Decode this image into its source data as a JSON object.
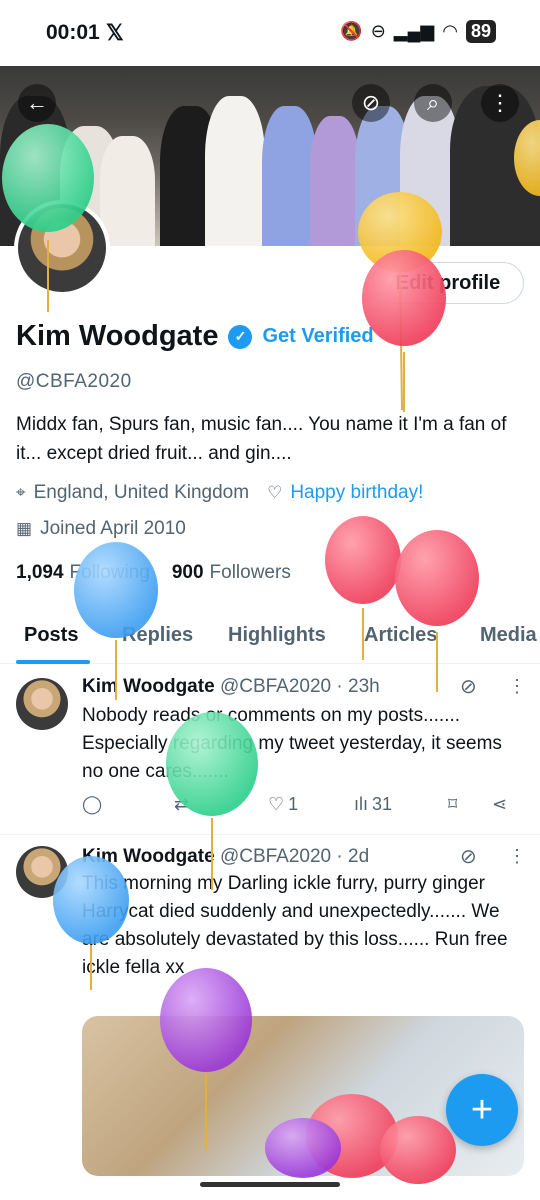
{
  "status_bar": {
    "time": "00:01",
    "x_glyph": "𝕏",
    "icons": [
      "mute-icon",
      "dnd-icon",
      "signal-icon",
      "wifi-icon"
    ],
    "battery": "89"
  },
  "banner": {
    "back_icon": "←",
    "grok_icon": "⊘",
    "search_icon": "⌕",
    "more_icon": "⋮"
  },
  "profile": {
    "edit_label": "Edit profile",
    "name": "Kim Woodgate",
    "verified_glyph": "✓",
    "get_verified": "Get Verified",
    "handle": "@CBFA2020",
    "bio": "Middx fan, Spurs fan, music fan.... You name it I'm a fan of it... except dried fruit... and gin....",
    "location": "England, United Kingdom",
    "birthday": "Happy birthday!",
    "joined": "Joined April 2010",
    "following_count": "1,094",
    "following_label": "Following",
    "followers_count": "900",
    "followers_label": "Followers"
  },
  "tabs": [
    "Posts",
    "Replies",
    "Highlights",
    "Articles",
    "Media"
  ],
  "tweets": [
    {
      "name": "Kim Woodgate",
      "meta": "@CBFA2020 · 23h",
      "text": "Nobody reads or comments on my posts....... Especially regarding my tweet yesterday, it seems no one cares.......",
      "likes": "1",
      "views": "31"
    },
    {
      "name": "Kim Woodgate",
      "meta": "@CBFA2020 · 2d",
      "text": "This morning my Darling ickle furry, purry ginger Harrycat died suddenly and unexpectedly....... We are absolutely devastated by this loss...... Run free ickle fella xx"
    }
  ],
  "fab_label": "+",
  "colors": {
    "accent": "#1d9bf0",
    "muted": "#536471"
  }
}
